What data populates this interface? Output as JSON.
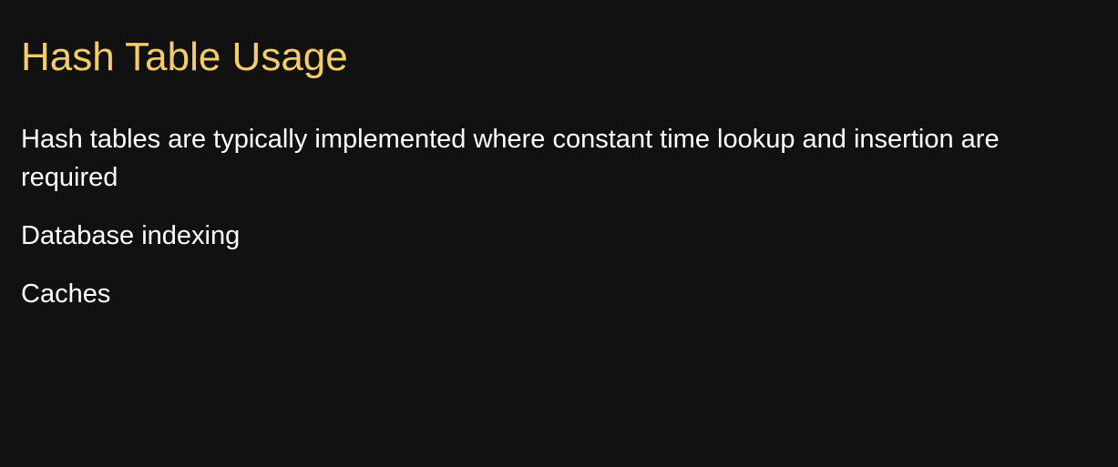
{
  "slide": {
    "title": "Hash Table Usage",
    "paragraphs": [
      "Hash tables are typically implemented where constant time lookup and insertion are required",
      "Database indexing",
      "Caches"
    ]
  },
  "colors": {
    "background": "#111111",
    "title": "#f5cd68",
    "text": "#ffffff"
  }
}
